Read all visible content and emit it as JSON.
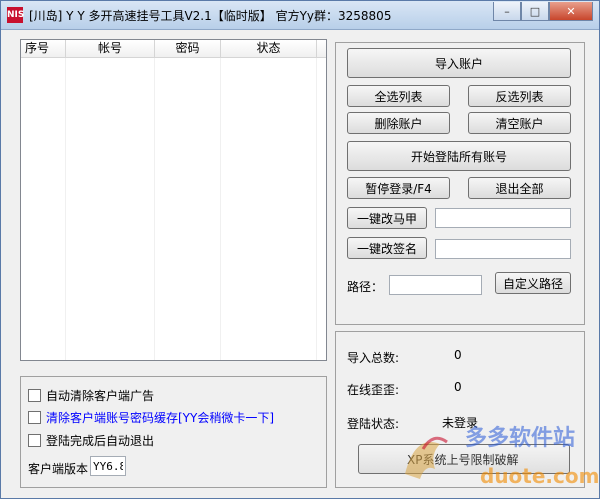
{
  "window": {
    "title": "[川岛] Y Y 多开高速挂号工具V2.1【临时版】   官方Yy群：3258805",
    "icon_text": "NIS",
    "controls": [
      "minimize-icon",
      "maximize-icon",
      "close-icon"
    ]
  },
  "list": {
    "columns": [
      "序号",
      "帐号",
      "密码",
      "状态"
    ],
    "rows": []
  },
  "buttons": {
    "import": "导入账户",
    "select_all": "全选列表",
    "invert_select": "反选列表",
    "delete": "删除账户",
    "clear": "清空账户",
    "login_all": "开始登陆所有账号",
    "pause": "暂停登录/F4",
    "exit_all": "退出全部",
    "change_vest": "一键改马甲",
    "change_sign": "一键改签名",
    "custom_path": "自定义路径"
  },
  "path": {
    "label": "路径：",
    "value": ""
  },
  "vest_input": "",
  "sign_input": "",
  "options": {
    "auto_clear_ads": "自动清除客户端广告",
    "clear_cache": "清除客户端账号密码缓存[YY会稍微卡一下]",
    "auto_exit": "登陆完成后自动退出",
    "client_version_label": "客户端版本",
    "client_version_value": "YY6.8"
  },
  "stats": {
    "import_total_label": "导入总数:",
    "import_total_value": "0",
    "online_label": "在线歪歪:",
    "online_value": "0",
    "status_label": "登陆状态:",
    "status_value": "未登录",
    "footer_note": "XP系统上号限制破解"
  },
  "watermark": {
    "site_name": "多多软件站",
    "domain": "duote.com"
  },
  "colors": {
    "title_bg": "#c5d8ef",
    "link_blue": "#0000ff",
    "watermark_blue": "#2a5bd7",
    "watermark_orange": "#f28b00"
  }
}
